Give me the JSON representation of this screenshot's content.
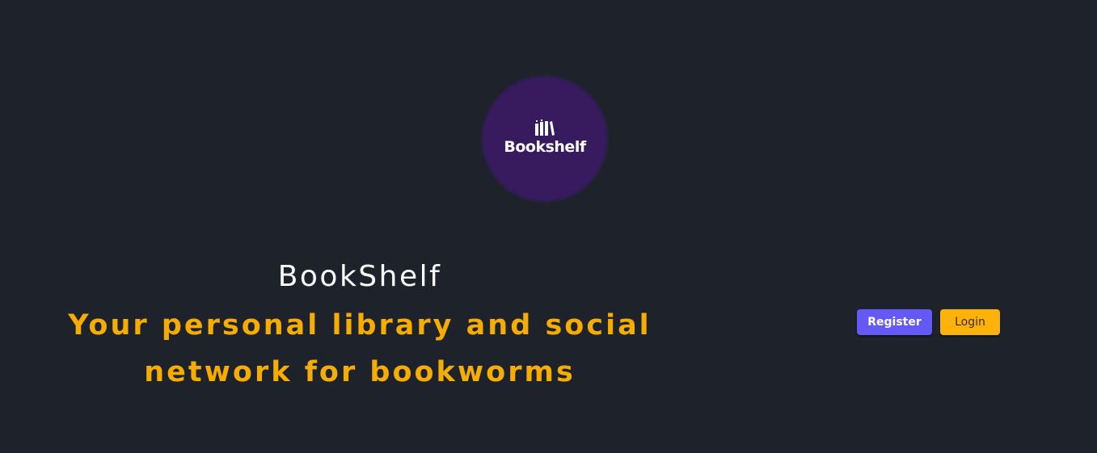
{
  "logo": {
    "text": "Bookshelf",
    "icon": "books-icon",
    "background_color": "#381a5e"
  },
  "hero": {
    "title": "BookShelf",
    "tagline_line1": "Your personal library and social",
    "tagline_line2": "network for bookworms",
    "tagline_color": "#f5ad06"
  },
  "actions": {
    "register_label": "Register",
    "login_label": "Login",
    "register_color": "#6459f6",
    "login_color": "#fdb20a"
  }
}
